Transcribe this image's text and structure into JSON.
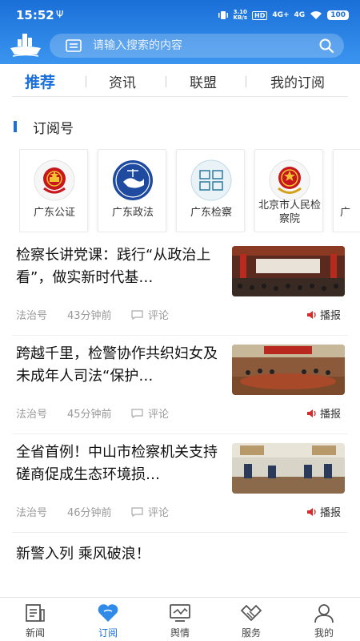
{
  "status_bar": {
    "time": "15:52",
    "usb": "Ψ",
    "speed_top": "3.10",
    "speed_bottom": "KB/s",
    "hd": "HD",
    "signal1": "4G+",
    "signal2": "4G",
    "battery": "100"
  },
  "search": {
    "placeholder": "请输入搜索的内容"
  },
  "tabs": [
    {
      "label": "推荐",
      "active": true
    },
    {
      "label": "资讯",
      "active": false
    },
    {
      "label": "联盟",
      "active": false
    },
    {
      "label": "我的订阅",
      "active": false
    }
  ],
  "subscriptions": {
    "title": "订阅号",
    "items": [
      {
        "name": "广东公证",
        "icon": "national-emblem-icon"
      },
      {
        "name": "广东政法",
        "icon": "guangdong-politics-law-icon"
      },
      {
        "name": "广东检察",
        "icon": "guangdong-procuratorate-icon"
      },
      {
        "name": "北京市人民检察院",
        "icon": "procuratorate-emblem-icon"
      },
      {
        "name": "广",
        "icon": "partial-card"
      }
    ]
  },
  "news": [
    {
      "title": "检察长讲党课：践行“从政治上看”，做实新时代基…",
      "source": "法治号",
      "time": "43分钟前",
      "comment": "评论",
      "broadcast": "播报"
    },
    {
      "title": "跨越千里，检警协作共织妇女及未成年人司法“保护…",
      "source": "法治号",
      "time": "45分钟前",
      "comment": "评论",
      "broadcast": "播报"
    },
    {
      "title": "全省首例！中山市检察机关支持磋商促成生态环境损…",
      "source": "法治号",
      "time": "46分钟前",
      "comment": "评论",
      "broadcast": "播报"
    },
    {
      "title": "新警入列 乘风破浪！"
    }
  ],
  "bottom_nav": [
    {
      "label": "新闻",
      "icon": "newspaper-icon",
      "active": false
    },
    {
      "label": "订阅",
      "icon": "heart-icon",
      "active": true
    },
    {
      "label": "舆情",
      "icon": "monitor-icon",
      "active": false
    },
    {
      "label": "服务",
      "icon": "handshake-icon",
      "active": false
    },
    {
      "label": "我的",
      "icon": "user-icon",
      "active": false
    }
  ],
  "colors": {
    "accent": "#1a6fd8",
    "broadcast": "#d62b2b",
    "emblem_red": "#c8161d"
  }
}
